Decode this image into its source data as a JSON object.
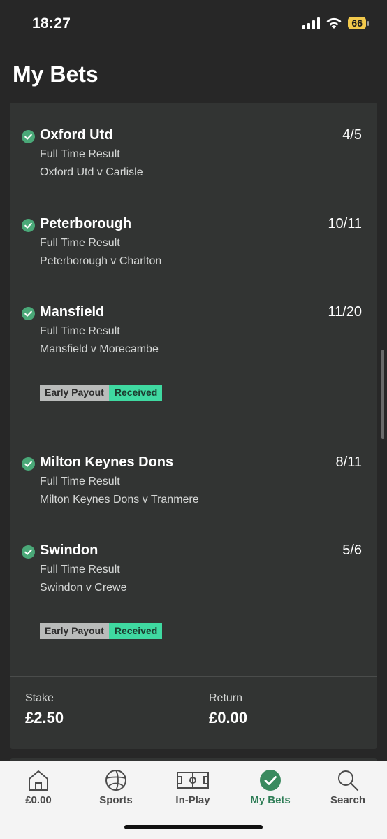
{
  "status_bar": {
    "time": "18:27",
    "battery": "66"
  },
  "header": {
    "title": "My Bets"
  },
  "selections": [
    {
      "team": "Oxford Utd",
      "odds": "4/5",
      "market": "Full Time Result",
      "event": "Oxford Utd v Carlisle",
      "early_payout": null
    },
    {
      "team": "Peterborough",
      "odds": "10/11",
      "market": "Full Time Result",
      "event": "Peterborough v Charlton",
      "early_payout": null
    },
    {
      "team": "Mansfield",
      "odds": "11/20",
      "market": "Full Time Result",
      "event": "Mansfield v Morecambe",
      "early_payout": {
        "label": "Early Payout",
        "status": "Received"
      }
    },
    {
      "team": "Milton Keynes Dons",
      "odds": "8/11",
      "market": "Full Time Result",
      "event": "Milton Keynes Dons v Tranmere",
      "early_payout": null
    },
    {
      "team": "Swindon",
      "odds": "5/6",
      "market": "Full Time Result",
      "event": "Swindon v Crewe",
      "early_payout": {
        "label": "Early Payout",
        "status": "Received"
      }
    }
  ],
  "summary": {
    "stake_label": "Stake",
    "stake_value": "£2.50",
    "return_label": "Return",
    "return_value": "£0.00"
  },
  "bottom_nav": [
    {
      "label": "£0.00",
      "icon": "home-icon",
      "active": false
    },
    {
      "label": "Sports",
      "icon": "football-icon",
      "active": false
    },
    {
      "label": "In-Play",
      "icon": "pitch-icon",
      "active": false
    },
    {
      "label": "My Bets",
      "icon": "check-circle-icon",
      "active": true
    },
    {
      "label": "Search",
      "icon": "search-icon",
      "active": false
    }
  ],
  "colors": {
    "accent": "#3a8a5f",
    "received": "#3fd9a1",
    "battery": "#f2c94c"
  }
}
